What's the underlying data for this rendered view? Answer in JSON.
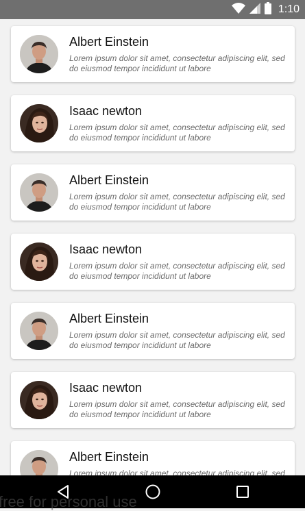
{
  "status_bar": {
    "time": "1:10",
    "icons": [
      "wifi-icon",
      "signal-icon",
      "battery-icon"
    ]
  },
  "list": {
    "items": [
      {
        "name": "Albert Einstein",
        "description": "Lorem ipsum dolor sit amet, consectetur adipiscing elit, sed do eiusmod tempor incididunt ut labore",
        "avatar": "man-portrait"
      },
      {
        "name": "Isaac newton",
        "description": "Lorem ipsum dolor sit amet, consectetur adipiscing elit, sed do eiusmod tempor incididunt ut labore",
        "avatar": "woman-portrait"
      },
      {
        "name": "Albert Einstein",
        "description": "Lorem ipsum dolor sit amet, consectetur adipiscing elit, sed do eiusmod tempor incididunt ut labore",
        "avatar": "man-portrait"
      },
      {
        "name": "Isaac newton",
        "description": "Lorem ipsum dolor sit amet, consectetur adipiscing elit, sed do eiusmod tempor incididunt ut labore",
        "avatar": "woman-portrait"
      },
      {
        "name": "Albert Einstein",
        "description": "Lorem ipsum dolor sit amet, consectetur adipiscing elit, sed do eiusmod tempor incididunt ut labore",
        "avatar": "man-portrait"
      },
      {
        "name": "Isaac newton",
        "description": "Lorem ipsum dolor sit amet, consectetur adipiscing elit, sed do eiusmod tempor incididunt ut labore",
        "avatar": "woman-portrait"
      },
      {
        "name": "Albert Einstein",
        "description": "Lorem ipsum dolor sit amet, consectetur adipiscing elit, sed do eiusmod tempor incididunt ut labore",
        "avatar": "man-portrait"
      }
    ]
  },
  "nav_bar": {
    "buttons": [
      "back-icon",
      "home-icon",
      "recents-icon"
    ]
  },
  "watermark": "free for personal use",
  "colors": {
    "status_bar": "#6f6f6f",
    "background": "#f2f2f2",
    "card": "#ffffff",
    "nav_bar": "#000000"
  }
}
